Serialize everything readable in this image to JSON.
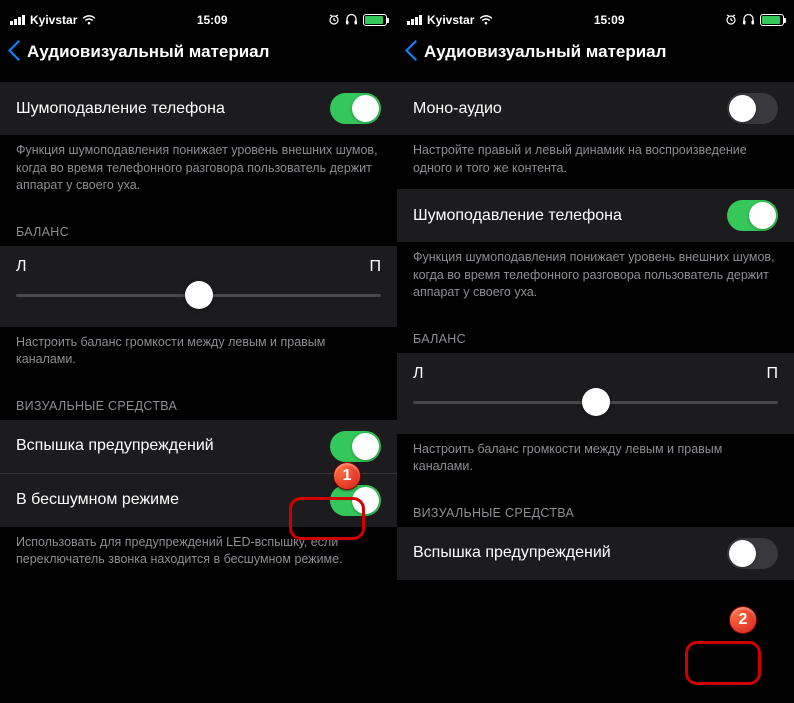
{
  "statusBar": {
    "carrier": "Kyivstar",
    "time": "15:09",
    "alarmIcon": "⏰",
    "headphonesIcon": "🎧"
  },
  "left": {
    "navTitle": "Аудиовизуальный материал",
    "rows": {
      "noiseCancel": {
        "label": "Шумоподавление телефона"
      },
      "noiseCancelDesc": "Функция шумоподавления понижает уровень внешних шумов, когда во время телефонного разговора пользователь держит аппарат у своего уха.",
      "balanceHeader": "БАЛАНС",
      "balanceLeft": "Л",
      "balanceRight": "П",
      "balanceDesc": "Настроить баланс громкости между левым и правым каналами.",
      "visualHeader": "ВИЗУАЛЬНЫЕ СРЕДСТВА",
      "flashAlerts": {
        "label": "Вспышка предупреждений"
      },
      "silentMode": {
        "label": "В бесшумном режиме"
      },
      "flashDesc": "Использовать для предупреждений LED-вспышку, если переключатель звонка находится в бесшумном режиме."
    }
  },
  "right": {
    "navTitle": "Аудиовизуальный материал",
    "rows": {
      "monoAudio": {
        "label": "Моно-аудио"
      },
      "monoDesc": "Настройте правый и левый динамик на воспроизведение одного и того же контента.",
      "noiseCancel": {
        "label": "Шумоподавление телефона"
      },
      "noiseCancelDesc": "Функция шумоподавления понижает уровень внешних шумов, когда во время телефонного разговора пользователь держит аппарат у своего уха.",
      "balanceHeader": "БАЛАНС",
      "balanceLeft": "Л",
      "balanceRight": "П",
      "balanceDesc": "Настроить баланс громкости между левым и правым каналами.",
      "visualHeader": "ВИЗУАЛЬНЫЕ СРЕДСТВА",
      "flashAlerts": {
        "label": "Вспышка предупреждений"
      }
    }
  },
  "callouts": {
    "badge1": "1",
    "badge2": "2"
  }
}
